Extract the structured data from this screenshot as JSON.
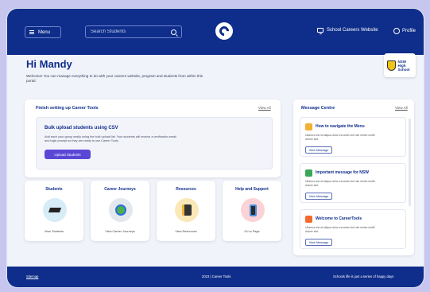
{
  "header": {
    "menu_label": "Menu",
    "search_placeholder": "Search Students",
    "website_link": "School Careers Website",
    "profile_label": "Profile"
  },
  "greeting": {
    "title": "Hi Mandy",
    "welcome": "Welcome! You can manage everything to do with your careers website, program and students from within this portal."
  },
  "school_badge": {
    "line1": "NSW",
    "line2": "High School"
  },
  "setup": {
    "title": "Finish setting up Career Tools",
    "view_all": "View All",
    "bulk_title": "Bulk upload students using CSV",
    "bulk_text": "Add each your group easily using the bulk upload list. Your students will receive a verification email and login prompt so they are ready to use Career Tools.",
    "button": "Upload Students"
  },
  "tiles": [
    {
      "title": "Students",
      "link": "View Students"
    },
    {
      "title": "Career Journeys",
      "link": "View Career Journeys"
    },
    {
      "title": "Resources",
      "link": "View Resources"
    },
    {
      "title": "Help and Support",
      "link": "Go to Page"
    }
  ],
  "messages": {
    "title": "Message Centre",
    "view_all": "View All",
    "items": [
      {
        "title": "How to navigate the Menu",
        "text": "Ullamco est sit aliqua dolor ea amet sint nisi minim mollit dolore sint.",
        "button": "View Message",
        "color": "#f2b134"
      },
      {
        "title": "Important message for NSW",
        "text": "Ullamco est sit aliqua dolor ea amet sint nisi minim mollit dolore sint.",
        "button": "View Message",
        "color": "#3aa757"
      },
      {
        "title": "Welcome to CareerTools",
        "text": "Ullamco est sit aliqua dolor ea amet sint nisi minim mollit dolore sint.",
        "button": "View Message",
        "color": "#f26a2e"
      }
    ]
  },
  "footer": {
    "sitemap": "Sitemap",
    "copyright": "2023 | Career Tools",
    "tagline": "Schools life is just a series of happy days"
  },
  "colors": {
    "brand": "#0f2d8a",
    "accent": "#5a47d6",
    "background": "#c7c6ef"
  }
}
